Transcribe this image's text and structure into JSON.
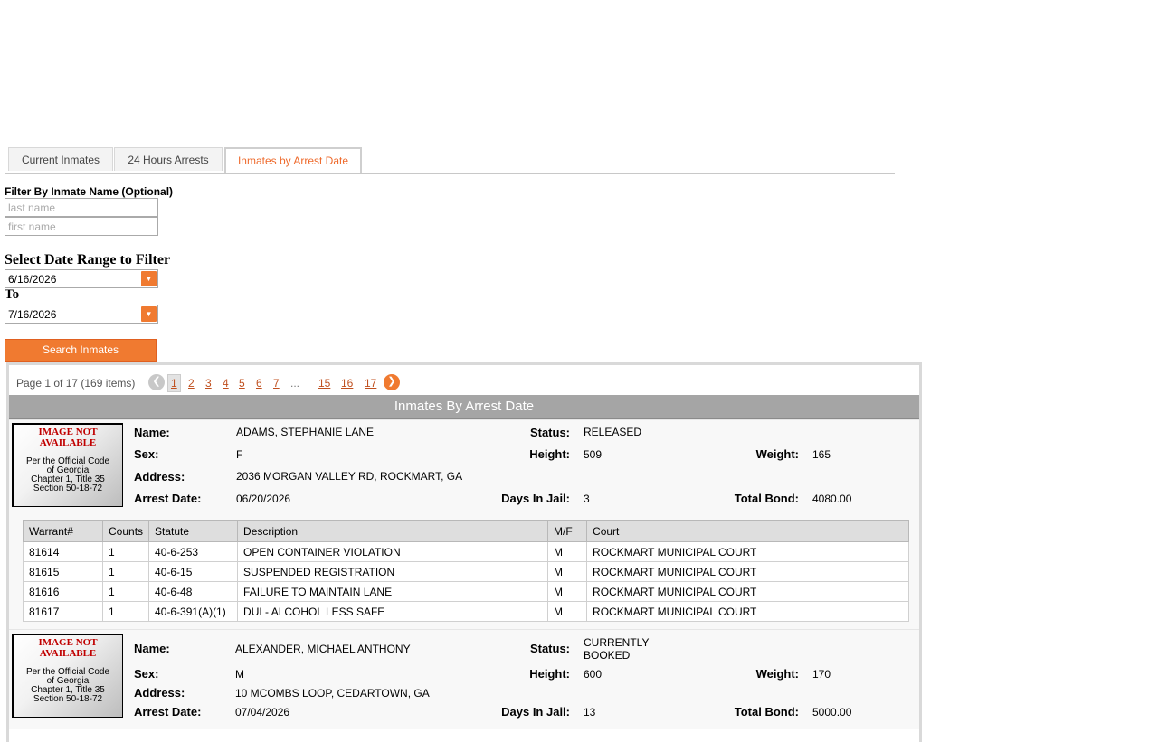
{
  "tabs": [
    {
      "label": "Current Inmates"
    },
    {
      "label": "24 Hours Arrests"
    },
    {
      "label": "Inmates by Arrest Date"
    }
  ],
  "filter": {
    "title": "Filter By Inmate Name (Optional)",
    "last_name_placeholder": "last name",
    "first_name_placeholder": "first name"
  },
  "date_range": {
    "title": "Select Date Range to Filter",
    "from": "6/16/2026",
    "to_label": "To",
    "to": "7/16/2026"
  },
  "search_button": "Search Inmates",
  "pager": {
    "info": "Page 1 of 17 (169 items)",
    "pages": [
      "1",
      "2",
      "3",
      "4",
      "5",
      "6",
      "7",
      "...",
      "15",
      "16",
      "17"
    ],
    "current": "1"
  },
  "grid_title": "Inmates By Arrest Date",
  "labels": {
    "name": "Name:",
    "status": "Status:",
    "sex": "Sex:",
    "height": "Height:",
    "weight": "Weight:",
    "address": "Address:",
    "arrest_date": "Arrest Date:",
    "days_in_jail": "Days In Jail:",
    "total_bond": "Total Bond:"
  },
  "photo": {
    "not_available": "IMAGE NOT AVAILABLE",
    "code_lines": [
      "Per the Official Code",
      "of Georgia",
      "Chapter 1, Title 35",
      "Section 50-18-72"
    ]
  },
  "warrant_columns": [
    "Warrant#",
    "Counts",
    "Statute",
    "Description",
    "M/F",
    "Court"
  ],
  "inmates": [
    {
      "name": "ADAMS, STEPHANIE LANE",
      "status": "RELEASED",
      "sex": "F",
      "height": "509",
      "weight": "165",
      "address": "2036 MORGAN VALLEY RD, ROCKMART, GA",
      "arrest_date": "06/20/2026",
      "days_in_jail": "3",
      "total_bond": "4080.00",
      "warrants": [
        {
          "warrant": "81614",
          "counts": "1",
          "statute": "40-6-253",
          "description": "OPEN CONTAINER VIOLATION",
          "mf": "M",
          "court": "ROCKMART MUNICIPAL COURT"
        },
        {
          "warrant": "81615",
          "counts": "1",
          "statute": "40-6-15",
          "description": "SUSPENDED REGISTRATION",
          "mf": "M",
          "court": "ROCKMART MUNICIPAL COURT"
        },
        {
          "warrant": "81616",
          "counts": "1",
          "statute": "40-6-48",
          "description": "FAILURE TO MAINTAIN LANE",
          "mf": "M",
          "court": "ROCKMART MUNICIPAL COURT"
        },
        {
          "warrant": "81617",
          "counts": "1",
          "statute": "40-6-391(A)(1)",
          "description": "DUI - ALCOHOL LESS SAFE",
          "mf": "M",
          "court": "ROCKMART MUNICIPAL COURT"
        }
      ]
    },
    {
      "name": "ALEXANDER, MICHAEL ANTHONY",
      "status_line1": "CURRENTLY",
      "status_line2": "BOOKED",
      "sex": "M",
      "height": "600",
      "weight": "170",
      "address": "10 MCOMBS LOOP, CEDARTOWN, GA",
      "arrest_date": "07/04/2026",
      "days_in_jail": "13",
      "total_bond": "5000.00"
    }
  ],
  "colors": {
    "accent": "#f07a30",
    "link": "#c0501f",
    "header_bg": "#a5a5a5",
    "not_available": "#c00000"
  }
}
